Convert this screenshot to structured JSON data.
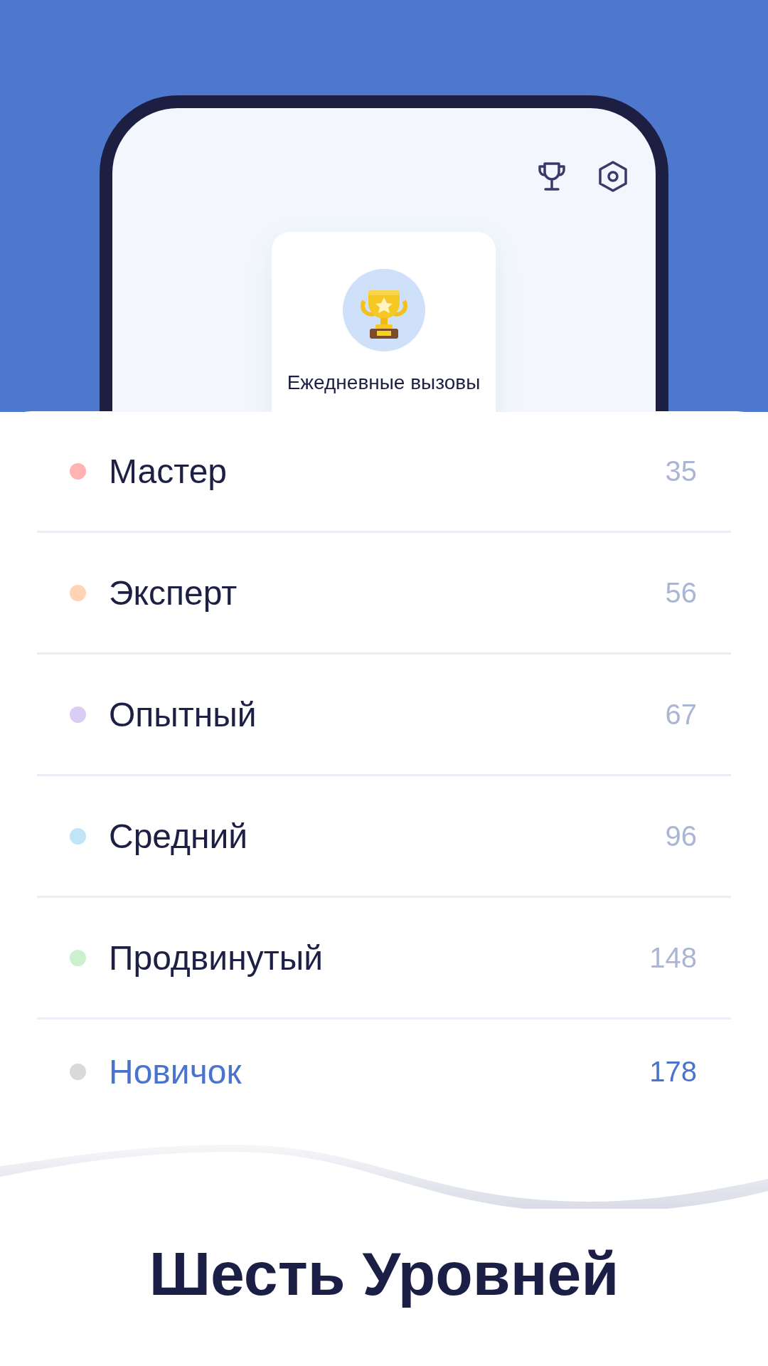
{
  "card": {
    "label": "Ежедневные вызовы"
  },
  "levels": [
    {
      "name": "Мастер",
      "count": "35",
      "color": "#ffb3b3",
      "selected": false
    },
    {
      "name": "Эксперт",
      "count": "56",
      "color": "#ffd3b3",
      "selected": false
    },
    {
      "name": "Опытный",
      "count": "67",
      "color": "#d9cdf5",
      "selected": false
    },
    {
      "name": "Средний",
      "count": "96",
      "color": "#c2e4f7",
      "selected": false
    },
    {
      "name": "Продвинутый",
      "count": "148",
      "color": "#cdf0cc",
      "selected": false
    },
    {
      "name": "Новичок",
      "count": "178",
      "color": "#d9d9dc",
      "selected": true
    }
  ],
  "headline": "Шесть Уровней"
}
